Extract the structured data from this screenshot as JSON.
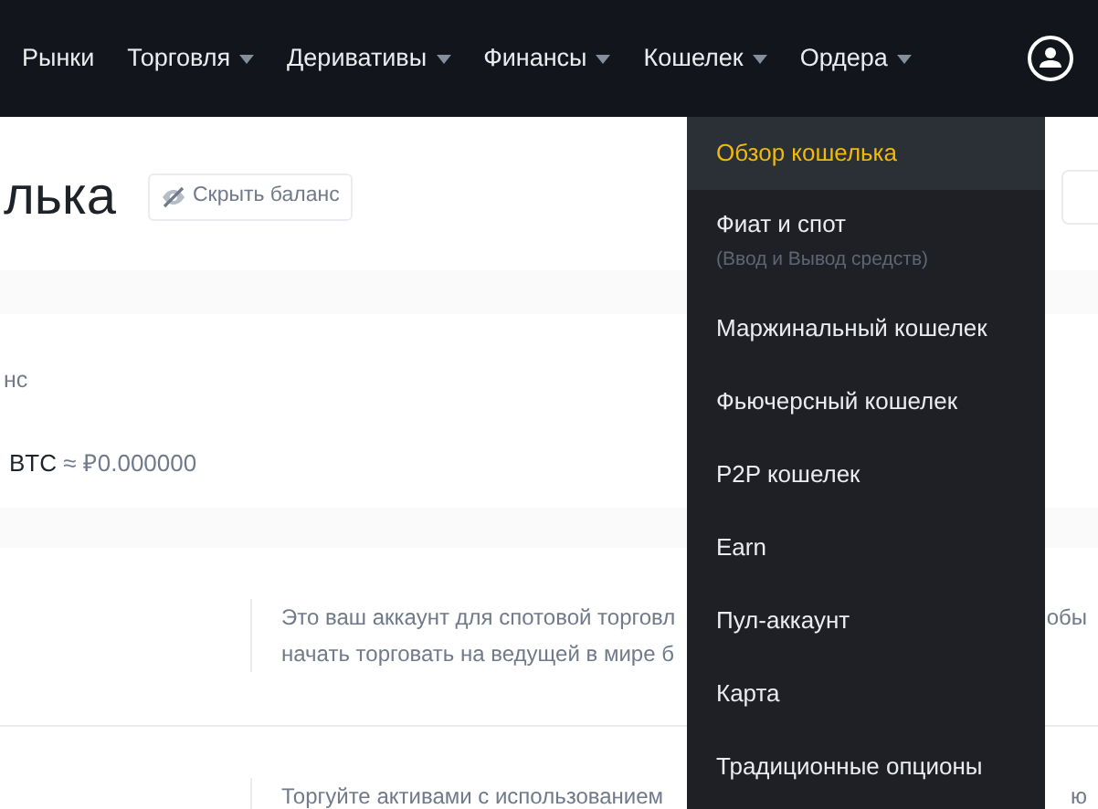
{
  "nav": [
    {
      "label": "Рынки",
      "caret": false
    },
    {
      "label": "Торговля",
      "caret": true
    },
    {
      "label": "Деривативы",
      "caret": true
    },
    {
      "label": "Финансы",
      "caret": true
    },
    {
      "label": "Кошелек",
      "caret": true
    },
    {
      "label": "Ордера",
      "caret": true
    }
  ],
  "page": {
    "title": "лька",
    "hide_button": "Скрыть баланс",
    "balance_label": "нс",
    "balance_value": "BTC",
    "balance_approx": "≈ ₽0.000000"
  },
  "accounts": [
    {
      "description": "Это ваш аккаунт для спотовой торговл",
      "description_end": "обы",
      "description_line2": "начать торговать на ведущей в мире б"
    },
    {
      "description": "Торгуйте активами с использованием",
      "description_end": "ю"
    }
  ],
  "wallet_menu": [
    {
      "label": "Обзор кошелька",
      "selected": true
    },
    {
      "label": "Фиат и спот",
      "note": "(Ввод и Вывод средств)",
      "selected": false
    },
    {
      "label": "Маржинальный кошелек",
      "selected": false
    },
    {
      "label": "Фьючерсный кошелек",
      "selected": false
    },
    {
      "label": "P2P кошелек",
      "selected": false
    },
    {
      "label": "Earn",
      "selected": false
    },
    {
      "label": "Пул-аккаунт",
      "selected": false
    },
    {
      "label": "Карта",
      "selected": false
    },
    {
      "label": "Традиционные опционы",
      "selected": false
    }
  ]
}
